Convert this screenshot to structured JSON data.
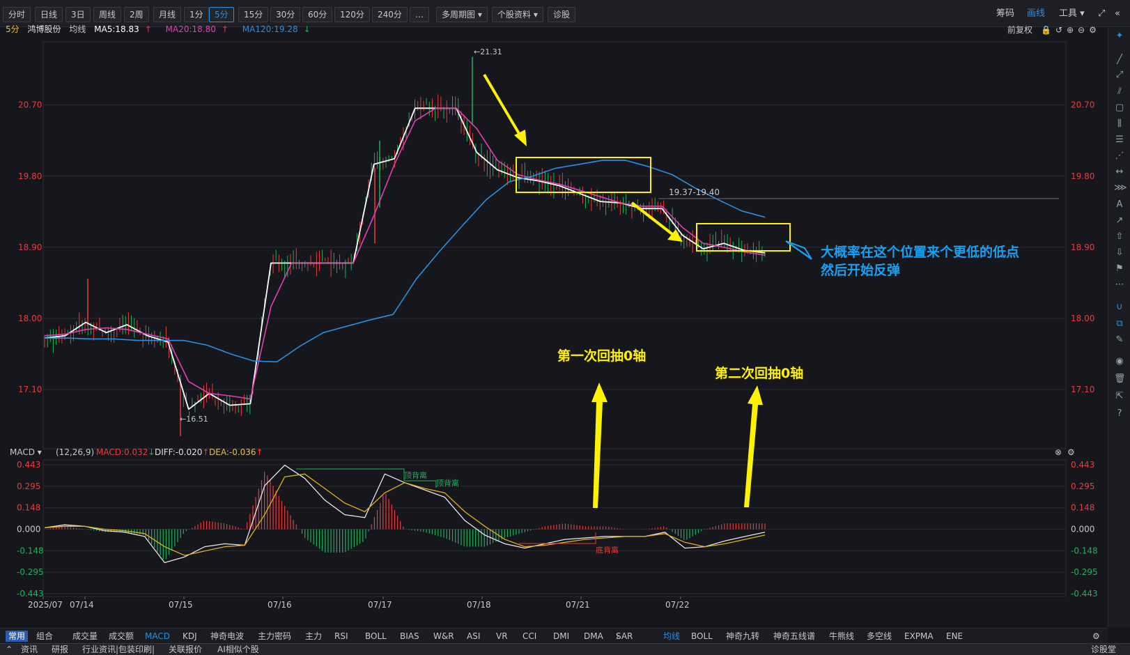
{
  "toolbar": {
    "buttons": [
      "分时",
      "日线",
      "3日",
      "周线",
      "2周",
      "月线",
      "1分",
      "5分",
      "15分",
      "30分",
      "60分",
      "120分",
      "240分",
      "…",
      "多周期图",
      "个股资料",
      "诊股"
    ],
    "active_index": 7,
    "right": {
      "chips": "筹码",
      "draw": "画线",
      "tools": "工具"
    }
  },
  "info": {
    "period": "5分",
    "name": "鸿博股份",
    "ma_label": "均线",
    "ma5": "MA5:18.83",
    "ma20": "MA20:18.80",
    "ma120": "MA120:19.28",
    "fq": "前复权"
  },
  "macd_header": {
    "name": "MACD",
    "params": "(12,26,9)",
    "macd": "MACD:0.032",
    "diff": "DIFF:-0.020",
    "dea": "DEA:-0.036"
  },
  "colors": {
    "ma5": "#ffffff",
    "ma20": "#e040b0",
    "ma120": "#2a8fe0",
    "up": "#e83b3b",
    "down": "#1fb05a",
    "annot": "#fff200",
    "bluetext": "#1aa0f0"
  },
  "chart_data": {
    "type": "line",
    "title": "",
    "x_ticks": [
      "2025/07",
      "07/14",
      "07/15",
      "07/16",
      "07/17",
      "07/18",
      "07/21",
      "07/22"
    ],
    "y_ticks": [
      17.1,
      18.0,
      18.9,
      19.8,
      20.7
    ],
    "ylim": [
      16.35,
      21.5
    ],
    "series": [
      {
        "name": "MA5",
        "values": [
          17.75,
          17.78,
          17.95,
          17.82,
          17.92,
          17.78,
          17.7,
          16.85,
          17.05,
          16.9,
          16.92,
          18.7,
          18.7,
          18.7,
          18.7,
          18.7,
          19.95,
          20.02,
          20.66,
          20.66,
          20.66,
          20.1,
          19.88,
          19.78,
          19.74,
          19.68,
          19.58,
          19.48,
          19.46,
          19.39,
          19.39,
          19.05,
          18.88,
          18.95,
          18.86,
          18.83
        ]
      },
      {
        "name": "MA20",
        "values": [
          17.78,
          17.8,
          17.86,
          17.88,
          17.86,
          17.8,
          17.74,
          17.2,
          17.05,
          17.02,
          16.98,
          18.15,
          18.7,
          18.7,
          18.7,
          18.7,
          19.3,
          19.95,
          20.5,
          20.66,
          20.66,
          20.4,
          20.0,
          19.82,
          19.75,
          19.7,
          19.62,
          19.54,
          19.46,
          19.42,
          19.42,
          19.15,
          18.95,
          18.9,
          18.84,
          18.8
        ]
      },
      {
        "name": "MA120",
        "values": [
          17.75,
          17.75,
          17.74,
          17.74,
          17.72,
          17.72,
          17.72,
          17.66,
          17.55,
          17.46,
          17.45,
          17.65,
          17.82,
          17.9,
          17.98,
          18.05,
          18.5,
          18.85,
          19.18,
          19.5,
          19.73,
          19.8,
          19.9,
          19.95,
          20.0,
          20.0,
          19.92,
          19.82,
          19.65,
          19.5,
          19.36,
          19.28
        ]
      }
    ],
    "annotations": {
      "high": "21.31",
      "low": "16.51",
      "range": "19.37-19.40",
      "text1": "大概率在这个位置来个更低的低点",
      "text2": "然后开始反弹",
      "pullback1": "第一次回抽0轴",
      "pullback2": "第二次回抽0轴"
    },
    "macd": {
      "y_ticks": [
        0.443,
        0.295,
        0.148,
        0.0,
        -0.148,
        -0.295,
        -0.443
      ],
      "ylim": [
        -0.443,
        0.443
      ],
      "diff": [
        0.01,
        0.03,
        0.02,
        -0.01,
        -0.02,
        -0.05,
        -0.23,
        -0.19,
        -0.12,
        -0.1,
        -0.11,
        0.3,
        0.44,
        0.35,
        0.2,
        0.1,
        0.08,
        0.38,
        0.32,
        0.27,
        0.22,
        0.06,
        -0.04,
        -0.1,
        -0.13,
        -0.1,
        -0.07,
        -0.06,
        -0.05,
        -0.05,
        -0.05,
        -0.02,
        -0.13,
        -0.12,
        -0.08,
        -0.05,
        -0.02
      ],
      "dea": [
        0.01,
        0.02,
        0.02,
        0.0,
        -0.01,
        -0.03,
        -0.12,
        -0.18,
        -0.15,
        -0.12,
        -0.11,
        0.1,
        0.36,
        0.38,
        0.28,
        0.18,
        0.12,
        0.25,
        0.32,
        0.28,
        0.25,
        0.12,
        0.02,
        -0.07,
        -0.12,
        -0.11,
        -0.09,
        -0.07,
        -0.06,
        -0.05,
        -0.05,
        -0.03,
        -0.09,
        -0.12,
        -0.1,
        -0.07,
        -0.04
      ],
      "labels": {
        "top_div1": "顶背离",
        "top_div2": "顶背离",
        "bottom_div": "底背离"
      }
    }
  },
  "tabs": {
    "left": [
      "常用",
      "组合"
    ],
    "indicators": [
      "成交量",
      "成交额",
      "MACD",
      "KDJ",
      "神奇电波",
      "主力密码",
      "主力",
      "RSI",
      "BOLL",
      "BIAS",
      "W&R",
      "ASI",
      "VR",
      "CCI",
      "DMI",
      "DMA",
      "SAR"
    ],
    "active_indicator": 2,
    "overlays": [
      "均线",
      "BOLL",
      "神奇九转",
      "神奇五线谱",
      "牛熊线",
      "多空线",
      "EXPMA",
      "ENE"
    ],
    "active_overlay": 0
  },
  "bottom_tabs": [
    "资讯",
    "研报",
    "行业资讯|包装印刷|",
    "关联报价",
    "AI相似个股",
    "诊股堂"
  ]
}
